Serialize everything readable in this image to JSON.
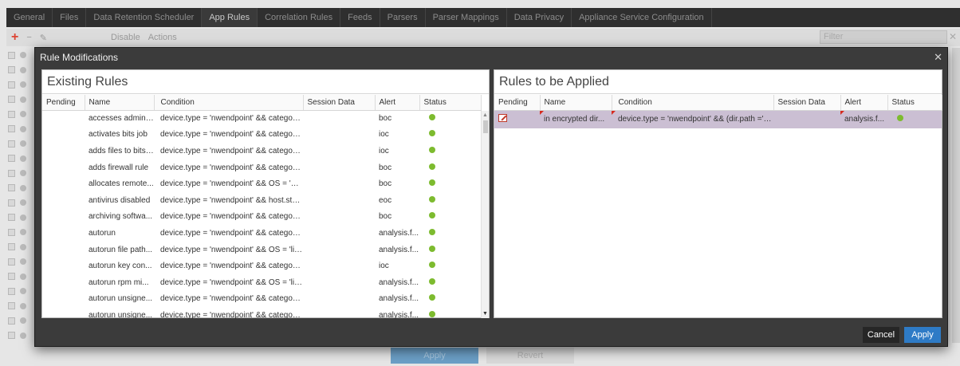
{
  "background": {
    "tabs": [
      "General",
      "Files",
      "Data Retention Scheduler",
      "App Rules",
      "Correlation Rules",
      "Feeds",
      "Parsers",
      "Parser Mappings",
      "Data Privacy",
      "Appliance Service Configuration"
    ],
    "active_tab": "App Rules",
    "toolbar": {
      "add": "+",
      "remove": "−",
      "edit": "✎",
      "disable": "Disable",
      "actions": "Actions"
    },
    "filter_placeholder": "Filter",
    "bottom_buttons": {
      "apply": "Apply",
      "revert": "Revert"
    }
  },
  "modal": {
    "title": "Rule Modifications",
    "close": "✕",
    "existing": {
      "title": "Existing Rules",
      "columns": [
        "Pending",
        "Name",
        "Condition",
        "Session Data",
        "Alert",
        "Status"
      ],
      "rows": [
        {
          "pending": "",
          "name": "accesses admini...",
          "condition": "device.type = 'nwendpoint' && category...",
          "session": "",
          "alert": "boc"
        },
        {
          "pending": "",
          "name": "activates bits job",
          "condition": "device.type = 'nwendpoint' && category...",
          "session": "",
          "alert": "ioc"
        },
        {
          "pending": "",
          "name": "adds files to bits ...",
          "condition": "device.type = 'nwendpoint' && category...",
          "session": "",
          "alert": "ioc"
        },
        {
          "pending": "",
          "name": "adds firewall rule",
          "condition": "device.type = 'nwendpoint' && category...",
          "session": "",
          "alert": "boc"
        },
        {
          "pending": "",
          "name": "allocates remote...",
          "condition": "device.type = 'nwendpoint' && OS = 'ma...",
          "session": "",
          "alert": "boc"
        },
        {
          "pending": "",
          "name": "antivirus disabled",
          "condition": "device.type = 'nwendpoint' && host.stat...",
          "session": "",
          "alert": "eoc"
        },
        {
          "pending": "",
          "name": "archiving softwa...",
          "condition": "device.type = 'nwendpoint' && category...",
          "session": "",
          "alert": "boc"
        },
        {
          "pending": "",
          "name": "autorun",
          "condition": "device.type = 'nwendpoint' && category...",
          "session": "",
          "alert": "analysis.f..."
        },
        {
          "pending": "",
          "name": "autorun file path...",
          "condition": "device.type = 'nwendpoint' && OS = 'lin...",
          "session": "",
          "alert": "analysis.f..."
        },
        {
          "pending": "",
          "name": "autorun key con...",
          "condition": "device.type = 'nwendpoint' && category...",
          "session": "",
          "alert": "ioc"
        },
        {
          "pending": "",
          "name": "autorun rpm mi...",
          "condition": "device.type = 'nwendpoint' && OS = 'lin...",
          "session": "",
          "alert": "analysis.f..."
        },
        {
          "pending": "",
          "name": "autorun unsigne...",
          "condition": "device.type = 'nwendpoint' && category...",
          "session": "",
          "alert": "analysis.f..."
        },
        {
          "pending": "",
          "name": "autorun unsigne...",
          "condition": "device.type = 'nwendpoint' && category...",
          "session": "",
          "alert": "analysis.f..."
        }
      ]
    },
    "applied": {
      "title": "Rules to be Applied",
      "columns": [
        "Pending",
        "Name",
        "Condition",
        "Session Data",
        "Alert",
        "Status"
      ],
      "rows": [
        {
          "pending_icon": "edit-icon",
          "name": "in encrypted dir...",
          "condition": "device.type = 'nwendpoint' && (dir.path ='e...",
          "session": "",
          "alert": "analysis.f..."
        }
      ]
    },
    "buttons": {
      "cancel": "Cancel",
      "apply": "Apply"
    },
    "status_color": "#7dbb2f",
    "accent_color": "#2e7bc6"
  }
}
